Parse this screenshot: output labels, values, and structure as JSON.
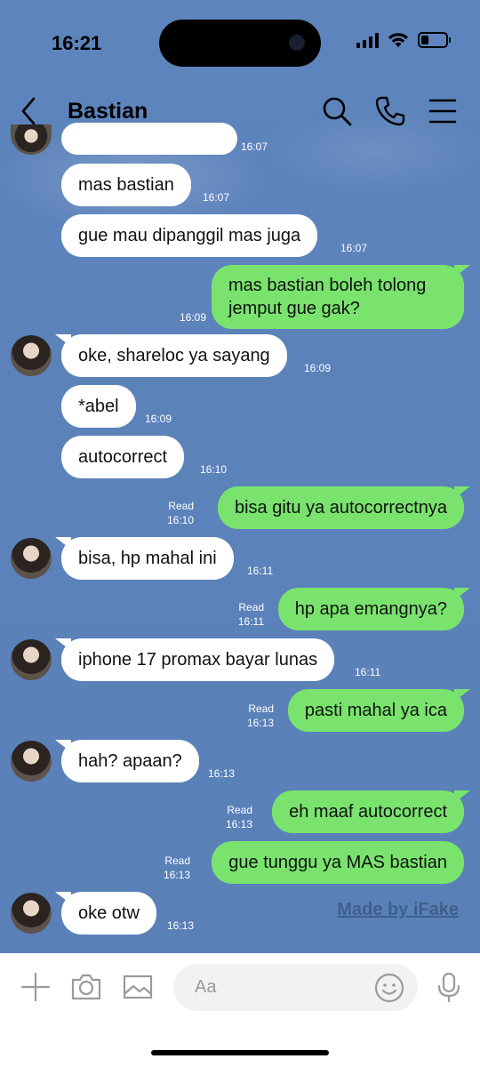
{
  "status": {
    "time": "16:21",
    "battery_level": 0.3
  },
  "header": {
    "contact_name": "Bastian"
  },
  "messages": [
    {
      "text": "mas bastian",
      "time": "16:07"
    },
    {
      "text": "gue mau dipanggil mas juga",
      "time": "16:07"
    },
    {
      "text": "mas bastian boleh tolong",
      "text2": "jemput gue gak?",
      "time": "16:09"
    },
    {
      "text": "oke, shareloc ya sayang",
      "time": "16:09"
    },
    {
      "text": "*abel",
      "time": "16:09"
    },
    {
      "text": "autocorrect",
      "time": "16:10"
    },
    {
      "text": "bisa gitu ya autocorrectnya",
      "read": "Read",
      "time": "16:10"
    },
    {
      "text": "bisa, hp mahal ini",
      "time": "16:11"
    },
    {
      "text": "hp apa emangnya?",
      "read": "Read",
      "time": "16:11"
    },
    {
      "text": "iphone 17 promax bayar lunas",
      "time": "16:11"
    },
    {
      "text": "pasti mahal ya ica",
      "read": "Read",
      "time": "16:13"
    },
    {
      "text": "hah? apaan?",
      "time": "16:13"
    },
    {
      "text": "eh maaf autocorrect",
      "read": "Read",
      "time": "16:13"
    },
    {
      "text": "gue tunggu ya MAS bastian",
      "read": "Read",
      "time": "16:13"
    },
    {
      "text": "oke otw",
      "time": "16:13"
    }
  ],
  "first_partial_time": "16:07",
  "watermark": "Made by iFake",
  "composer": {
    "placeholder": "Aa"
  },
  "colors": {
    "background": "#5b82b8",
    "outgoing_bubble": "#79e36e",
    "incoming_bubble": "#ffffff"
  },
  "icons": [
    "back-icon",
    "search-icon",
    "phone-icon",
    "menu-icon",
    "plus-icon",
    "camera-icon",
    "image-icon",
    "emoji-icon",
    "microphone-icon"
  ]
}
